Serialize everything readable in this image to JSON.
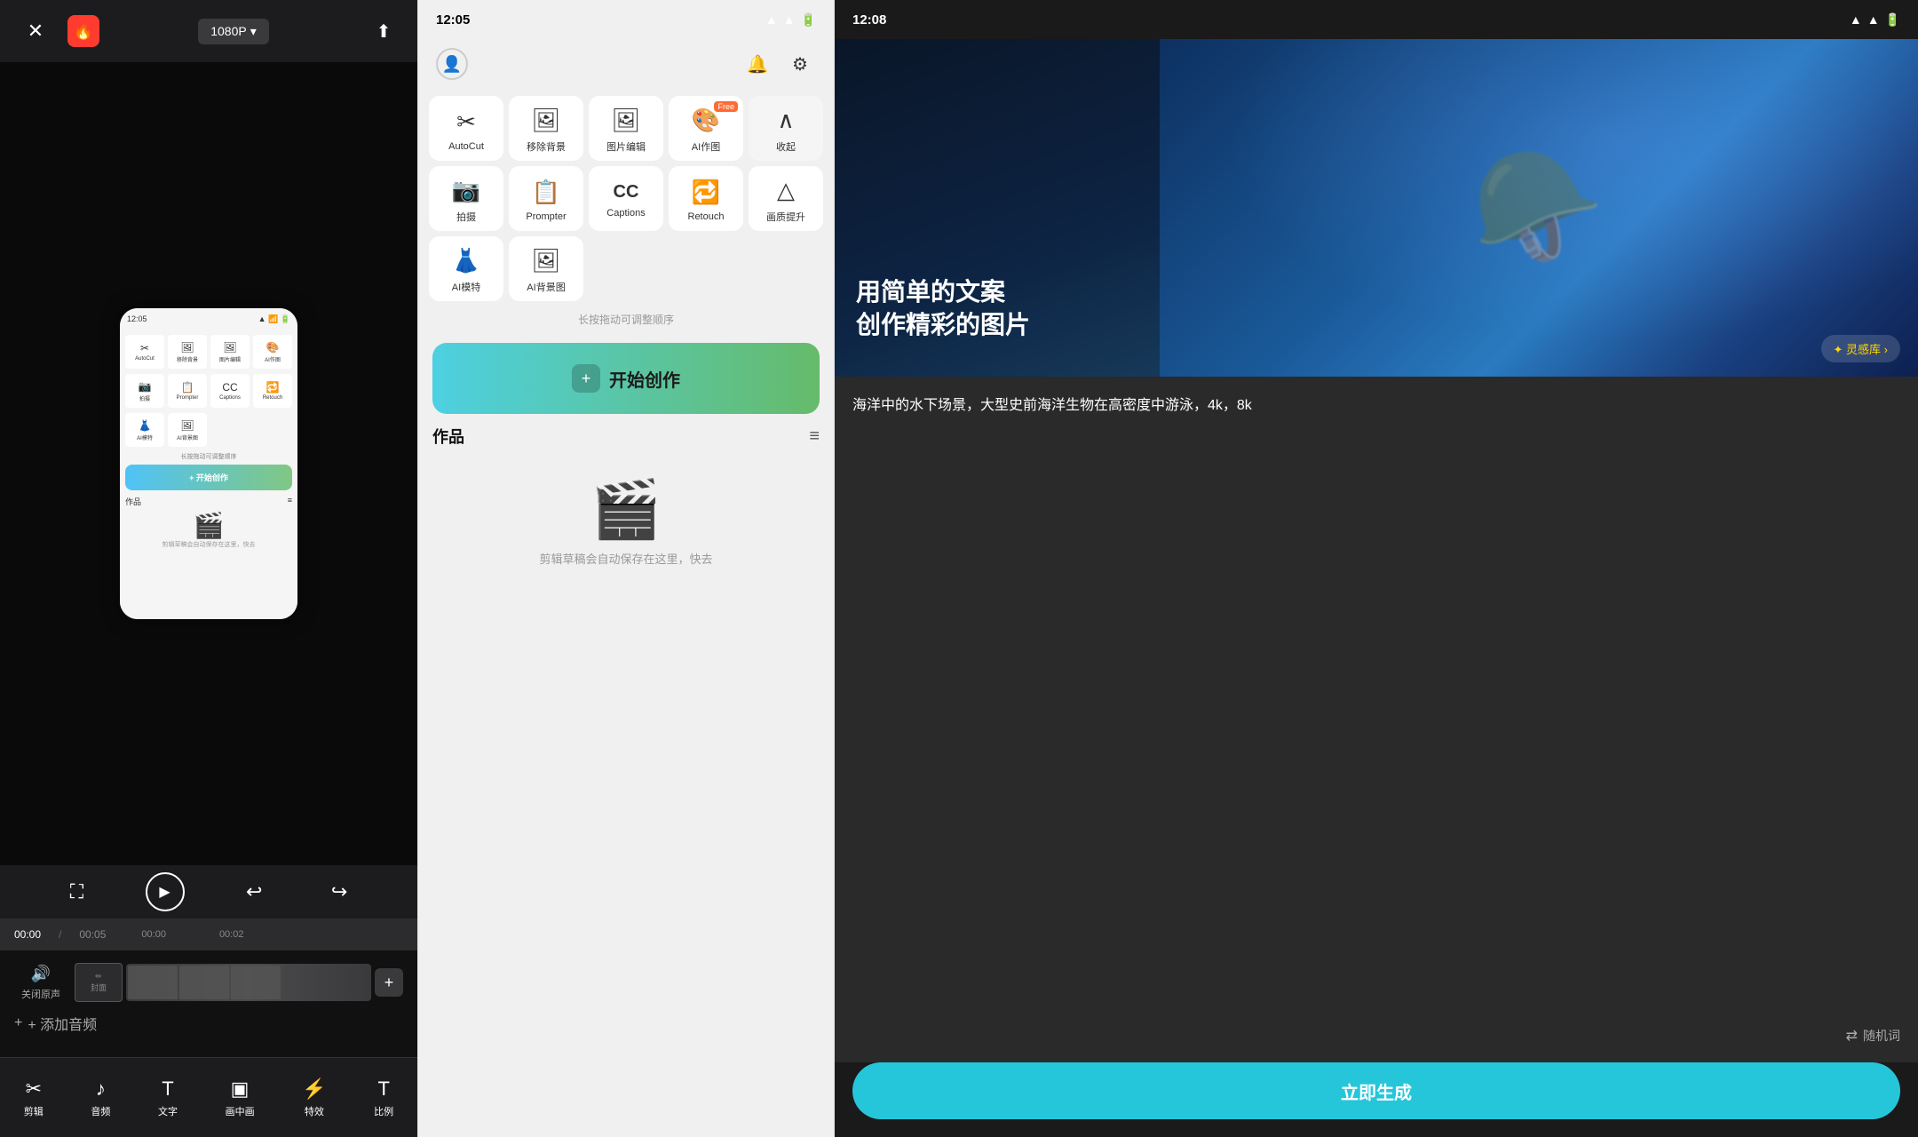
{
  "editor": {
    "resolution": "1080P",
    "close_label": "✕",
    "upload_icon": "⬆",
    "time_current": "00:00",
    "time_total": "00:05",
    "time_mark1": "00:00",
    "time_mark2": "00:02",
    "track_audio_label": "关闭原声",
    "track_cover_label": "封面",
    "add_audio_label": "+ 添加音频",
    "tools": [
      {
        "label": "剪辑",
        "icon": "✂"
      },
      {
        "label": "音频",
        "icon": "♪"
      },
      {
        "label": "文字",
        "icon": "T"
      },
      {
        "label": "画中画",
        "icon": "▣"
      },
      {
        "label": "特效",
        "icon": "⚡"
      },
      {
        "label": "比例",
        "icon": "T"
      }
    ],
    "preview_time": "12:05"
  },
  "home": {
    "status_time": "12:05",
    "tools_row1": [
      {
        "label": "AutoCut",
        "icon": "✂️",
        "free": false
      },
      {
        "label": "移除背景",
        "icon": "🖼",
        "free": false
      },
      {
        "label": "图片编辑",
        "icon": "🖼",
        "free": false
      },
      {
        "label": "AI作图",
        "icon": "🖼",
        "free": true
      },
      {
        "label": "收起",
        "icon": "∧",
        "free": false
      }
    ],
    "tools_row2": [
      {
        "label": "拍摄",
        "icon": "📷",
        "free": false
      },
      {
        "label": "Prompter",
        "icon": "📋",
        "free": false
      },
      {
        "label": "Captions",
        "icon": "CC",
        "free": false
      },
      {
        "label": "Retouch",
        "icon": "🔁",
        "free": false
      },
      {
        "label": "画质提升",
        "icon": "△",
        "free": false
      }
    ],
    "tools_row3": [
      {
        "label": "AI模特",
        "icon": "👗",
        "free": false
      },
      {
        "label": "AI背景图",
        "icon": "🖼",
        "free": false
      }
    ],
    "drag_hint": "长按拖动可调整顺序",
    "start_button": "开始创作",
    "works_title": "作品",
    "empty_hint": "剪辑草稿会自动保存在这里，快去",
    "user_icon": "👤",
    "bell_icon": "🔔",
    "settings_icon": "⚙"
  },
  "ai_gen": {
    "status_time": "12:08",
    "hero_title_line1": "用简单的文案",
    "hero_title_line2": "创作精彩的图片",
    "inspire_label": "✦ 灵感库 ›",
    "prompt_text": "海洋中的水下场景，大型史前海洋生物在高密度中游泳，4k，8k",
    "random_label": "随机词",
    "generate_label": "立即生成",
    "close_icon": "✕"
  }
}
